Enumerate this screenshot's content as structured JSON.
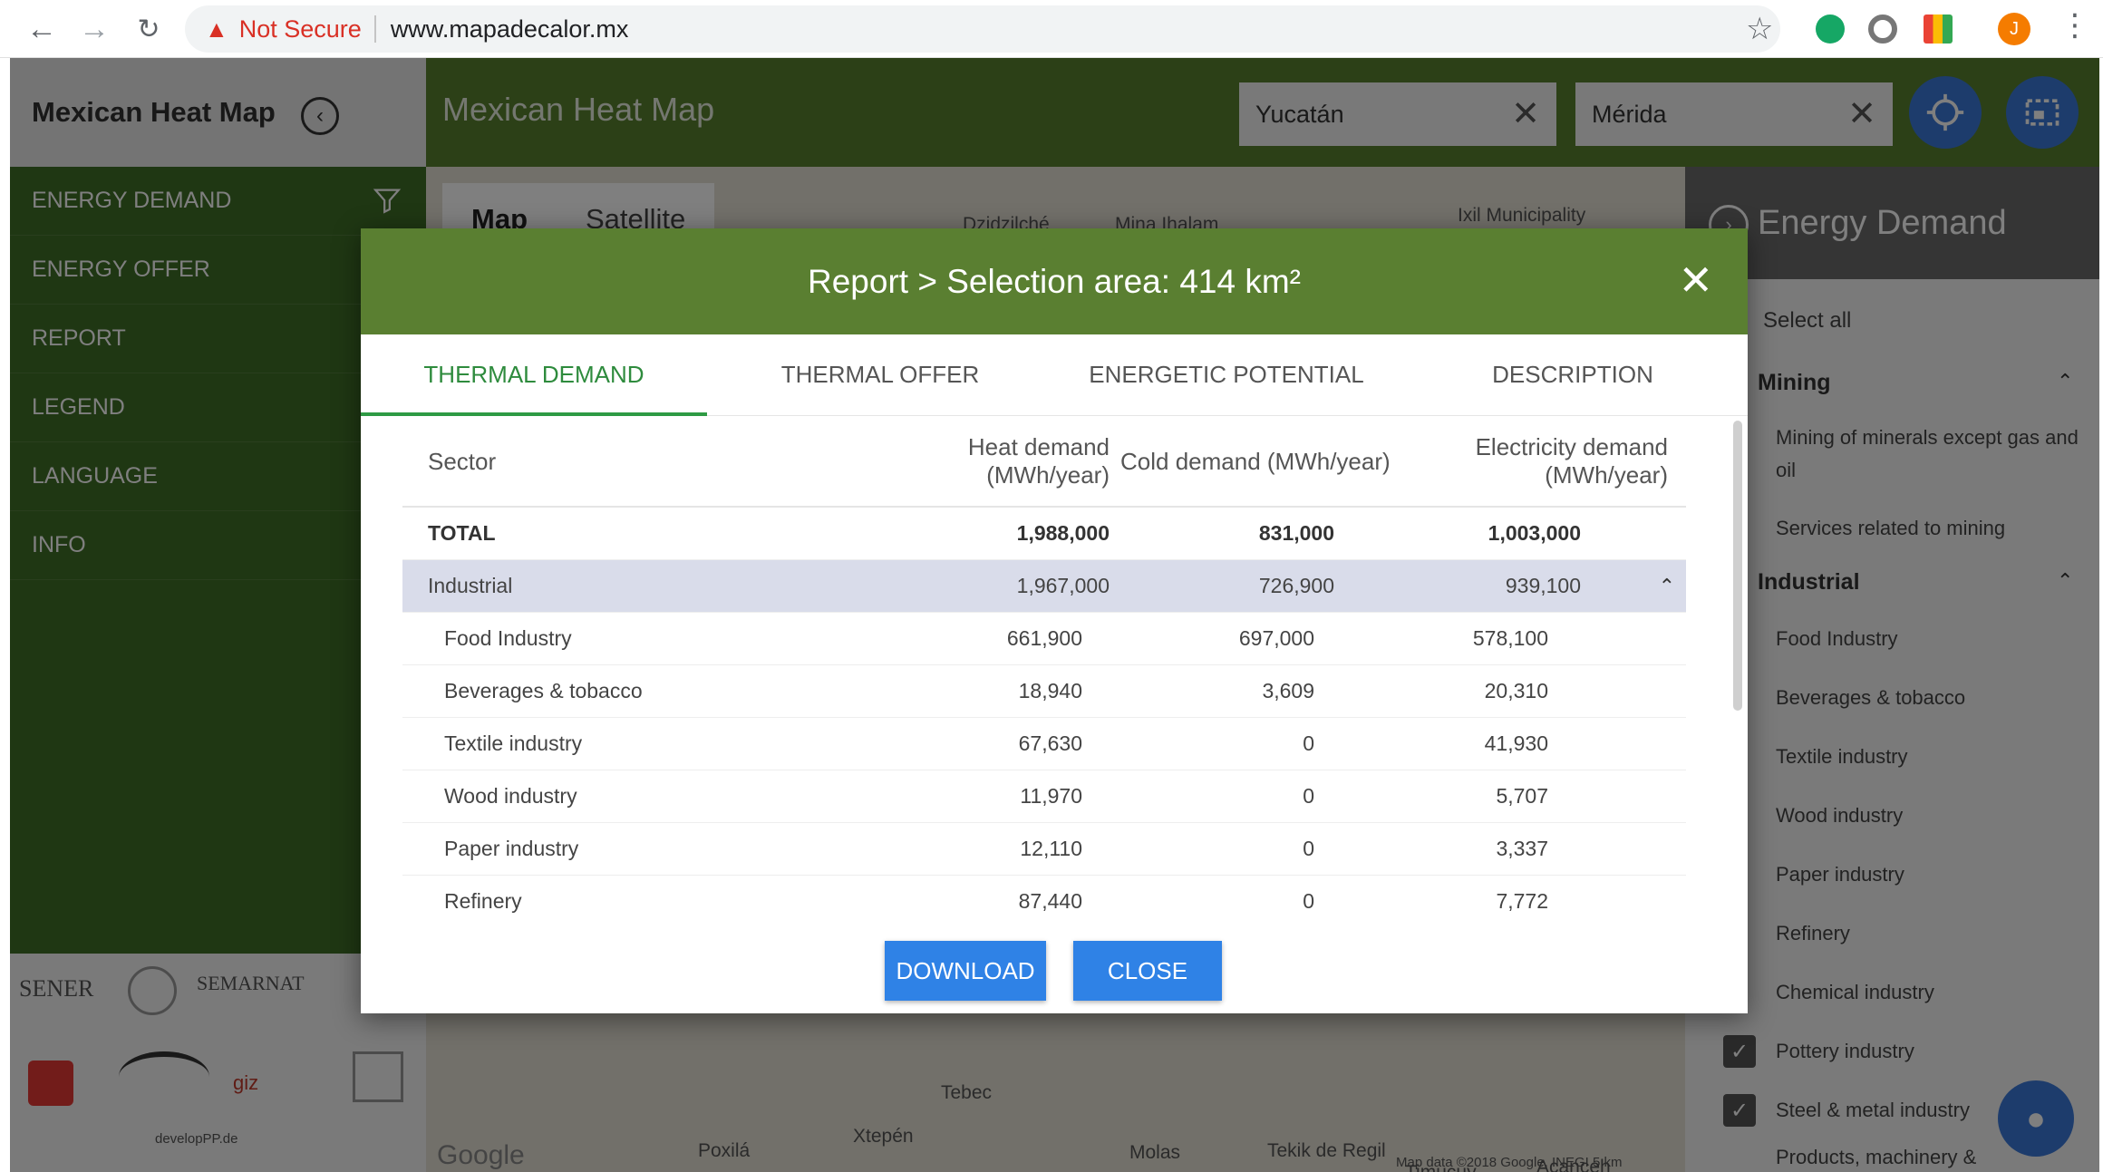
{
  "browser": {
    "security_label": "Not Secure",
    "url": "www.mapadecalor.mx",
    "profile_initial": "J"
  },
  "sidebar": {
    "title": "Mexican Heat Map",
    "items": [
      {
        "label": "ENERGY DEMAND"
      },
      {
        "label": "ENERGY OFFER"
      },
      {
        "label": "REPORT"
      },
      {
        "label": "LEGEND"
      },
      {
        "label": "LANGUAGE"
      },
      {
        "label": "INFO"
      }
    ],
    "logos": {
      "sener": "SENER",
      "semarnat": "SEMARNAT",
      "giz": "giz",
      "develop": "developPP.de"
    }
  },
  "header": {
    "title": "Mexican Heat Map",
    "state_value": "Yucatán",
    "city_value": "Mérida"
  },
  "map": {
    "tabs": [
      "Map",
      "Satellite"
    ],
    "labels": [
      "Dzidzilché",
      "Mina Ihalam",
      "Ixil Municipality",
      "Tebec",
      "Xtepén",
      "Poxilá",
      "Molas",
      "Tekik de Regil",
      "Timucuy",
      "Acanceh",
      "Google",
      "Map data ©2018 Google, INEGI 5 km"
    ]
  },
  "right_panel": {
    "title": "Energy Demand",
    "select_all": "Select all",
    "groups": [
      "Mining",
      "Industrial"
    ],
    "mining_items": [
      "Mining of minerals except gas and",
      "oil",
      "Services related to mining"
    ],
    "industrial_items": [
      "Food Industry",
      "Beverages & tobacco",
      "Textile industry",
      "Wood industry",
      "Paper industry",
      "Refinery",
      "Chemical industry",
      "Pottery industry",
      "Steel & metal industry",
      "Products, machinery &"
    ]
  },
  "modal": {
    "title": "Report > Selection area: 414 km²",
    "tabs": [
      "THERMAL DEMAND",
      "THERMAL OFFER",
      "ENERGETIC POTENTIAL",
      "DESCRIPTION"
    ],
    "columns": {
      "sector": "Sector",
      "heat_1": "Heat demand",
      "heat_2": "(MWh/year)",
      "cold": "Cold demand (MWh/year)",
      "elec_1": "Electricity demand",
      "elec_2": "(MWh/year)"
    },
    "total": {
      "sector": "TOTAL",
      "heat": "1,988,000",
      "cold": "831,000",
      "elec": "1,003,000"
    },
    "group": {
      "sector": "Industrial",
      "heat": "1,967,000",
      "cold": "726,900",
      "elec": "939,100"
    },
    "rows": [
      {
        "sector": "Food Industry",
        "heat": "661,900",
        "cold": "697,000",
        "elec": "578,100"
      },
      {
        "sector": "Beverages & tobacco",
        "heat": "18,940",
        "cold": "3,609",
        "elec": "20,310"
      },
      {
        "sector": "Textile industry",
        "heat": "67,630",
        "cold": "0",
        "elec": "41,930"
      },
      {
        "sector": "Wood industry",
        "heat": "11,970",
        "cold": "0",
        "elec": "5,707"
      },
      {
        "sector": "Paper industry",
        "heat": "12,110",
        "cold": "0",
        "elec": "3,337"
      },
      {
        "sector": "Refinery",
        "heat": "87,440",
        "cold": "0",
        "elec": "7,772"
      }
    ],
    "download_label": "DOWNLOAD",
    "close_label": "CLOSE"
  }
}
